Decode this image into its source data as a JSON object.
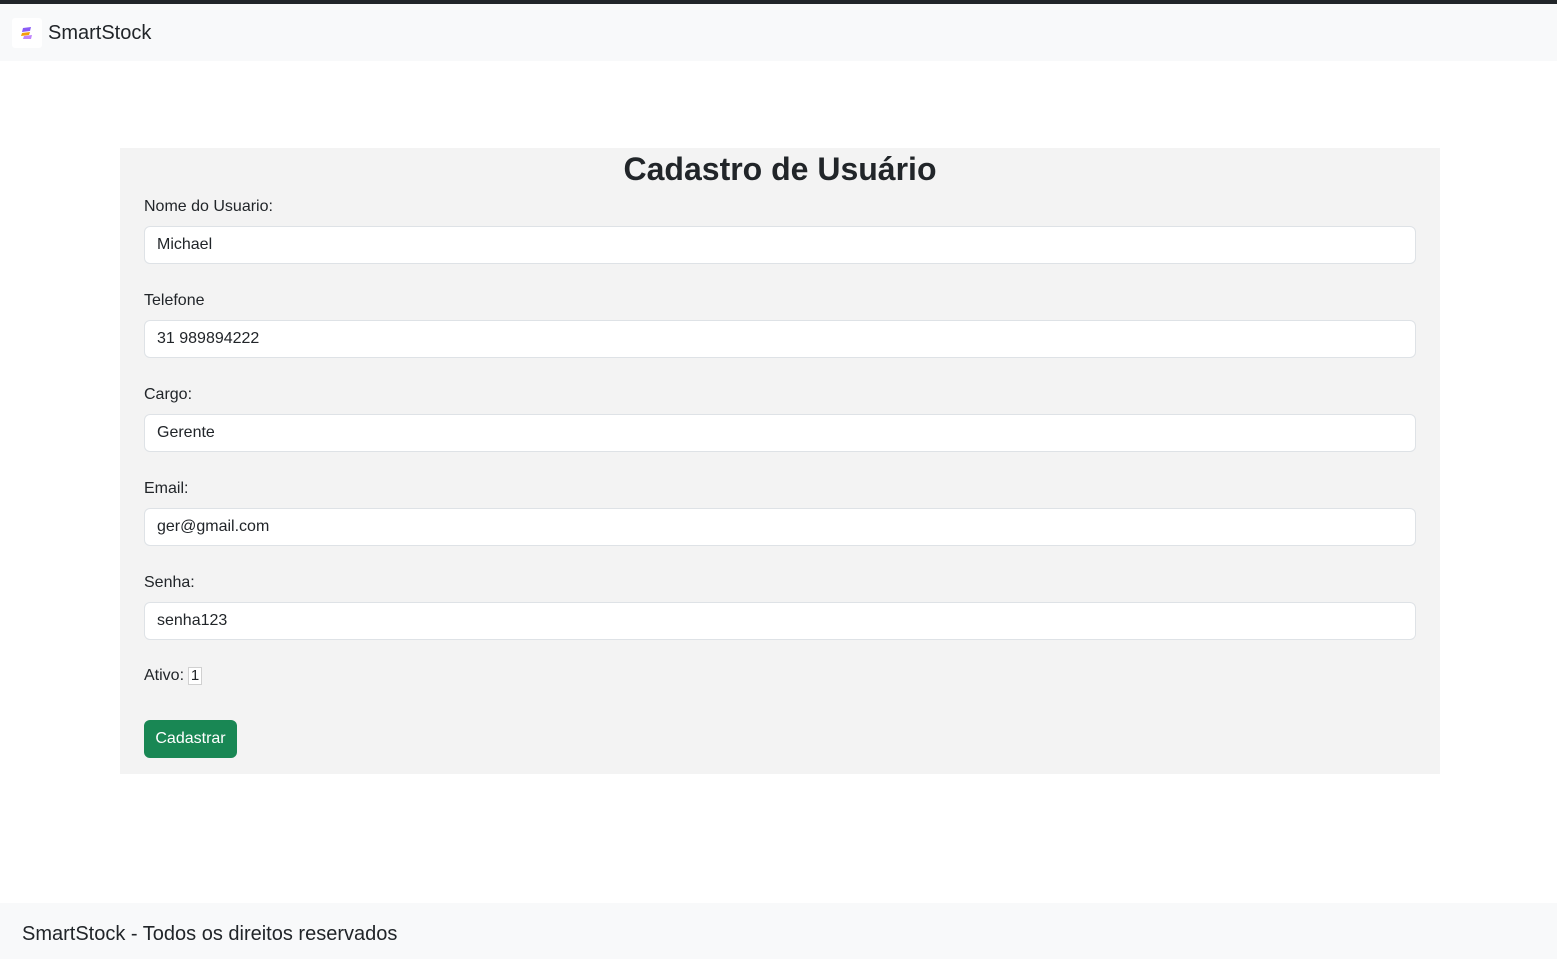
{
  "navbar": {
    "brand_name": "SmartStock",
    "logo_icon": "stack-logo-icon"
  },
  "form": {
    "title": "Cadastro de Usuário",
    "fields": [
      {
        "label": "Nome do Usuario:",
        "value": "Michael"
      },
      {
        "label": "Telefone",
        "value": "31 989894222"
      },
      {
        "label": "Cargo:",
        "value": "Gerente"
      },
      {
        "label": "Email:",
        "value": "ger@gmail.com"
      },
      {
        "label": "Senha:",
        "value": "senha123"
      }
    ],
    "ativo_label": "Ativo:",
    "ativo_value": "1",
    "submit_label": "Cadastrar"
  },
  "footer": {
    "text": "SmartStock - Todos os direitos reservados"
  },
  "colors": {
    "submit_button": "#198754",
    "navbar_bg": "#f8f9fa",
    "form_bg": "#f3f3f3"
  }
}
